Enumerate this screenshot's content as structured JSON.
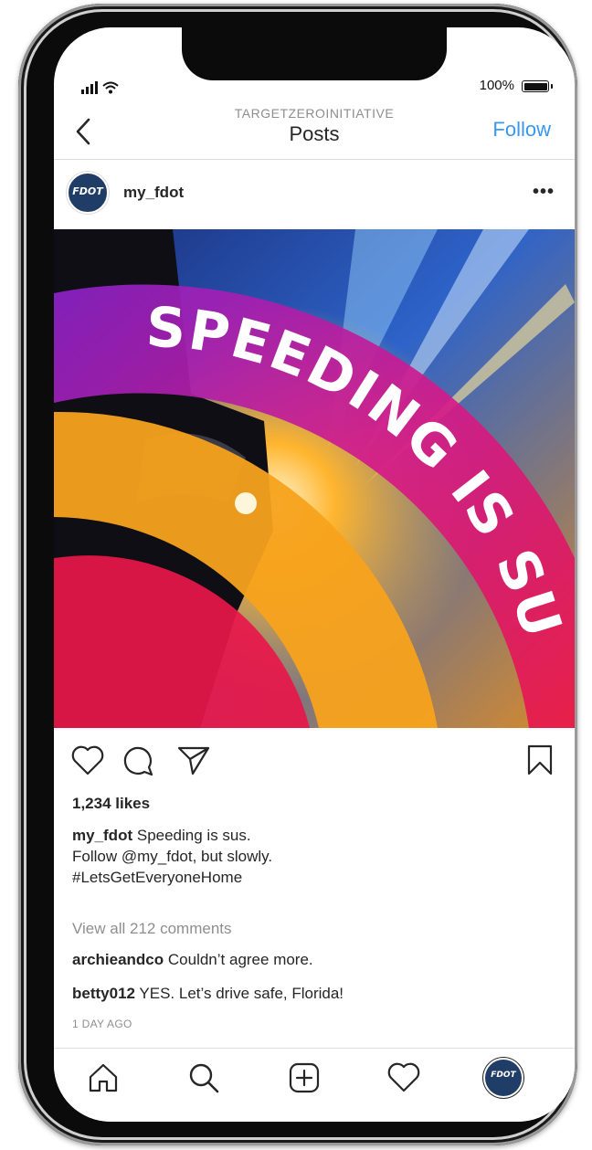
{
  "status_bar": {
    "battery_text": "100%",
    "battery_level": 1.0
  },
  "nav": {
    "subtitle": "TARGETZEROINITIATIVE",
    "title": "Posts",
    "follow_label": "Follow"
  },
  "post": {
    "username": "my_fdot",
    "avatar_text": "FDOT",
    "image_headline_line1": "SPEEDING",
    "image_headline_line2": "IS SUS.",
    "likes": "1,234 likes",
    "caption_user": "my_fdot",
    "caption_lines": [
      "Speeding is sus.",
      "Follow @my_fdot, but slowly.",
      "#LetsGetEveryoneHome"
    ],
    "view_comments": "View all 212 comments",
    "comments": [
      {
        "user": "archieandco",
        "text": "Couldn’t agree more."
      },
      {
        "user": "betty012",
        "text": "YES. Let’s drive safe, Florida!"
      }
    ],
    "time": "1 DAY AGO"
  },
  "tabbar": {
    "avatar_text": "FDOT"
  },
  "colors": {
    "follow": "#3897f0",
    "avatar_bg": "#1f3d66",
    "text": "#262626",
    "muted": "#8e8e8e"
  },
  "icons": {
    "back": "chevron-left-icon",
    "more": "more-horizontal-icon",
    "like": "heart-icon",
    "comment": "comment-icon",
    "share": "send-icon",
    "save": "bookmark-icon",
    "home": "home-icon",
    "search": "search-icon",
    "add": "add-post-icon",
    "activity": "heart-icon"
  }
}
